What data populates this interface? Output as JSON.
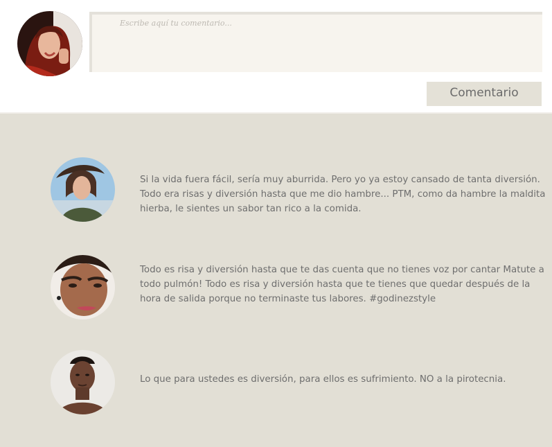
{
  "composer": {
    "placeholder": "Escribe aquí tu comentario...",
    "submit_label": "Comentario"
  },
  "comments": [
    {
      "text": "Si la vida fuera fácil, sería muy aburrida. Pero yo ya estoy cansado de tanta diversión. Todo era risas y diversión hasta que me dio hambre... PTM, como da hambre la maldita hierba, le sientes un sabor tan rico a la comida."
    },
    {
      "text": "Todo es risa y diversión hasta que te das cuenta que no tienes voz por cantar Matute a todo pulmón! Todo es risa y diversión hasta que te tienes que quedar después de la hora de salida porque no terminaste tus labores. #godinezstyle"
    },
    {
      "text": "Lo que para ustedes es diversión, para ellos es sufrimiento. NO a la pirotecnia."
    }
  ],
  "colors": {
    "feed_background": "#e2dfd5",
    "comment_box_background": "#f7f4ee",
    "button_background": "#e4e1d7",
    "text": "#6e6e6e"
  }
}
